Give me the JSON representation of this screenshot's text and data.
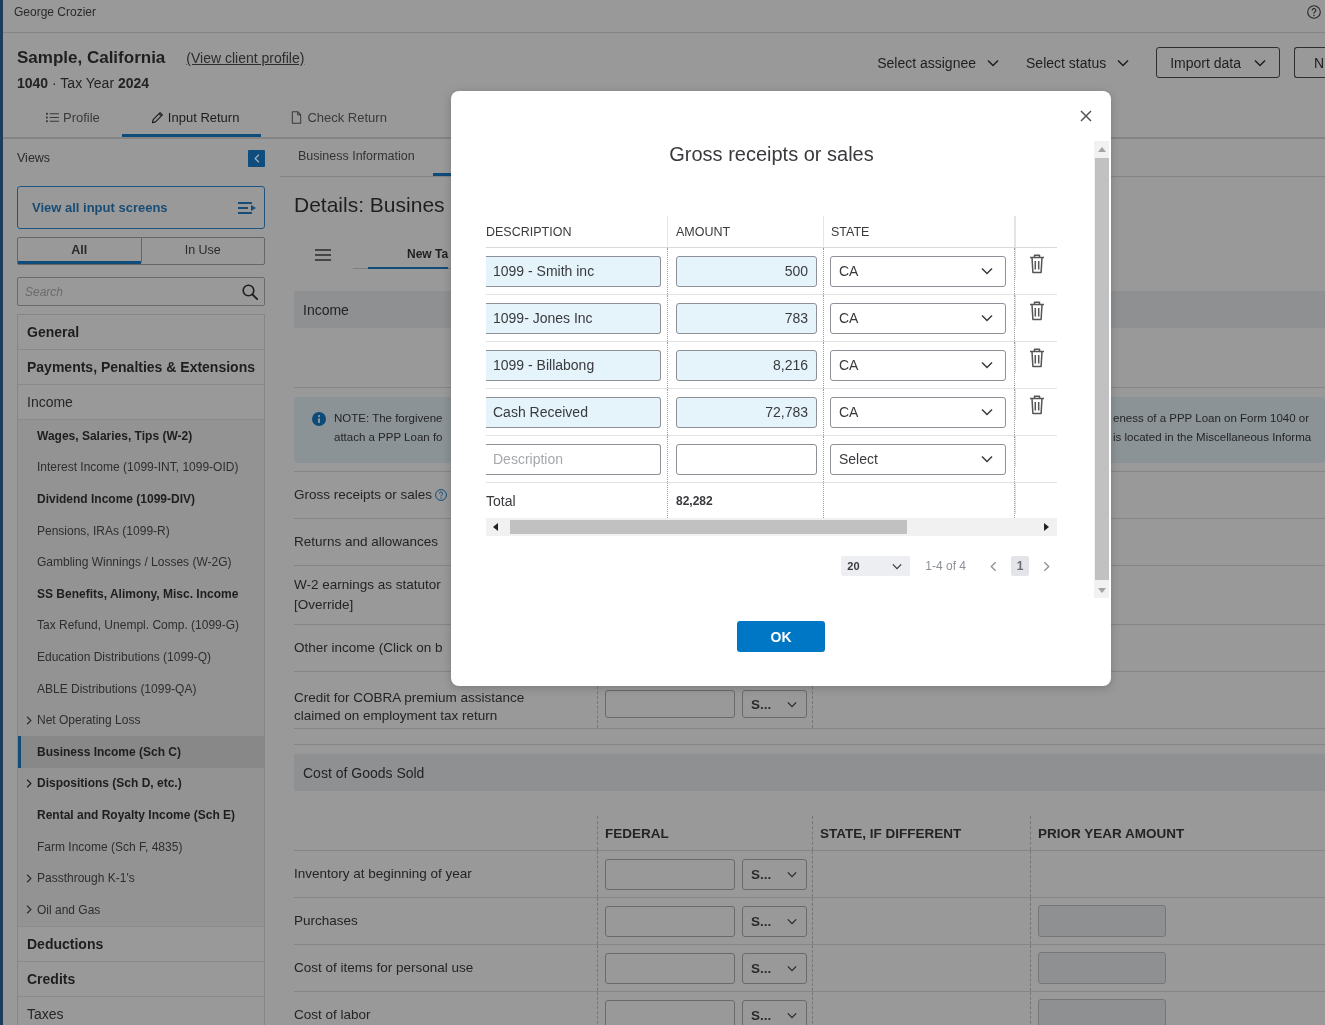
{
  "top_bar": {
    "user": "George Crozier"
  },
  "client": {
    "name": "Sample, California",
    "profile_link": "(View client profile)",
    "return_info": "**1040** · Tax Year **2024**"
  },
  "actions": [
    {
      "kind": "menu",
      "label": "Select assignee"
    },
    {
      "kind": "menu",
      "label": "Select status"
    },
    {
      "kind": "dropbutton",
      "label": "Import data"
    },
    {
      "kind": "button",
      "label": "N"
    }
  ],
  "tabs": [
    {
      "label": "Profile",
      "selected": false
    },
    {
      "label": "Input Return",
      "selected": true
    },
    {
      "label": "Check Return",
      "selected": false
    }
  ],
  "sidebar": {
    "title": "Views",
    "view_all": "View all input screens",
    "filters": [
      {
        "label": "All",
        "selected": true
      },
      {
        "label": "In Use",
        "selected": false
      }
    ],
    "search": {
      "placeholder": "Search"
    },
    "items": [
      {
        "label": "General",
        "in_use": true,
        "selected": false
      },
      {
        "label": "Payments, Penalties & Extensions",
        "in_use": true,
        "selected": false
      },
      {
        "label": "Income",
        "in_use": false,
        "selected": false,
        "children": [
          {
            "label": "Wages, Salaries, Tips (W-2)",
            "kind": "screen",
            "in_use": true,
            "selected": false
          },
          {
            "label": "Interest Income (1099-INT, 1099-OID)",
            "kind": "screen",
            "in_use": false,
            "selected": false
          },
          {
            "label": "Dividend Income (1099-DIV)",
            "kind": "screen",
            "in_use": true,
            "selected": false
          },
          {
            "label": "Pensions, IRAs (1099-R)",
            "kind": "screen",
            "in_use": false,
            "selected": false
          },
          {
            "label": "Gambling Winnings / Losses (W-2G)",
            "kind": "screen",
            "in_use": false,
            "selected": false
          },
          {
            "label": "SS Benefits, Alimony, Misc. Income",
            "kind": "screen",
            "in_use": true,
            "selected": false
          },
          {
            "label": "Tax Refund, Unempl. Comp. (1099-G)",
            "kind": "screen",
            "in_use": false,
            "selected": false
          },
          {
            "label": "Education Distributions (1099-Q)",
            "kind": "screen",
            "in_use": false,
            "selected": false
          },
          {
            "label": "ABLE Distributions (1099-QA)",
            "kind": "screen",
            "in_use": false,
            "selected": false
          },
          {
            "label": "Net Operating Loss",
            "kind": "group",
            "in_use": false,
            "selected": false
          },
          {
            "label": "Business Income (Sch C)",
            "kind": "screen",
            "in_use": true,
            "selected": true
          },
          {
            "label": "Dispositions (Sch D, etc.)",
            "kind": "group",
            "in_use": true,
            "selected": false
          },
          {
            "label": "Rental and Royalty Income (Sch E)",
            "kind": "screen",
            "in_use": true,
            "selected": false
          },
          {
            "label": "Farm Income (Sch F, 4835)",
            "kind": "screen",
            "in_use": false,
            "selected": false
          },
          {
            "label": "Passthrough K-1's",
            "kind": "group",
            "in_use": false,
            "selected": false
          },
          {
            "label": "Oil and Gas",
            "kind": "group",
            "in_use": false,
            "selected": false
          }
        ]
      },
      {
        "label": "Deductions",
        "in_use": true,
        "selected": false
      },
      {
        "label": "Credits",
        "in_use": true,
        "selected": false
      },
      {
        "label": "Taxes",
        "in_use": false,
        "selected": false
      }
    ]
  },
  "content": {
    "section_tabs": [
      {
        "label": "Business Information",
        "selected": false
      }
    ],
    "title": "Details: Busines",
    "detail_tabs": [
      {
        "label": "New Ta",
        "selected": true
      }
    ],
    "income": {
      "title": "Income",
      "note": {
        "left": "NOTE: The forgivene\nattach a PPP Loan fo",
        "right": "eness of a PPP Loan on Form 1040 or\nis located in the Miscellaneous Informa"
      },
      "rows": [
        {
          "kind": "text",
          "label": "Gross receipts or sales",
          "help": true
        },
        {
          "kind": "text",
          "label": "Returns and allowances",
          "help": false
        },
        {
          "kind": "text",
          "label": "W-2 earnings as statutor\n[Override]",
          "help": false
        },
        {
          "kind": "text",
          "label": "Other income (Click on b",
          "help": false
        },
        {
          "kind": "entry",
          "label": "Credit for COBRA premium assistance claimed on employment tax return",
          "help": false,
          "select": "S..."
        }
      ]
    },
    "cost_of_goods": {
      "title": "Cost of Goods Sold",
      "columns": [
        "FEDERAL",
        "STATE, IF DIFFERENT",
        "PRIOR YEAR AMOUNT"
      ],
      "rows": [
        {
          "label": "Inventory at beginning of year",
          "select": "S...",
          "prior_year_field": false
        },
        {
          "label": "Purchases",
          "select": "S...",
          "prior_year_field": true
        },
        {
          "label": "Cost of items for personal use",
          "select": "S...",
          "prior_year_field": true
        },
        {
          "label": "Cost of labor",
          "select": "S...",
          "prior_year_field": true
        }
      ]
    }
  },
  "modal": {
    "title": "Gross receipts or sales",
    "columns": [
      "DESCRIPTION",
      "AMOUNT",
      "STATE"
    ],
    "rows": [
      {
        "kind": "entry",
        "description": "1099 - Smith inc",
        "amount": "500",
        "state": "CA"
      },
      {
        "kind": "entry",
        "description": "1099- Jones Inc",
        "amount": "783",
        "state": "CA"
      },
      {
        "kind": "entry",
        "description": "1099 - Billabong",
        "amount": "8,216",
        "state": "CA"
      },
      {
        "kind": "entry",
        "description": "Cash Received",
        "amount": "72,783",
        "state": "CA"
      },
      {
        "kind": "new",
        "description_placeholder": "Description",
        "state_placeholder": "Select"
      }
    ],
    "total": {
      "label": "Total",
      "amount": "82,282"
    },
    "pagination": {
      "page_size": "20",
      "range": "1-4 of 4",
      "pages": [
        {
          "label": "1",
          "selected": true
        }
      ]
    },
    "ok": "OK"
  }
}
